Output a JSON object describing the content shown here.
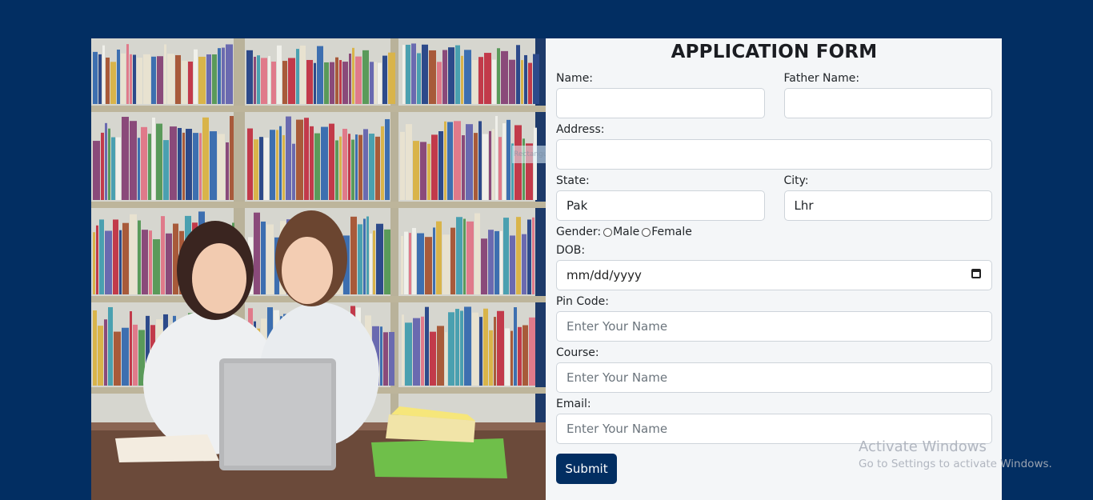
{
  "form": {
    "title": "APPLICATION FORM",
    "name_label": "Name:",
    "name_value": "",
    "father_label": "Father Name:",
    "father_value": "",
    "address_label": "Address:",
    "address_value": "",
    "state_label": "State:",
    "state_value": "Pak",
    "city_label": "City:",
    "city_value": "Lhr",
    "gender_label": "Gender:",
    "gender_options": [
      "Male",
      "Female"
    ],
    "dob_label": "DOB:",
    "dob_placeholder": "mm/dd/yyyy",
    "pin_label": "Pin Code:",
    "pin_placeholder": "Enter Your Name",
    "course_label": "Course:",
    "course_placeholder": "Enter Your Name",
    "email_label": "Email:",
    "email_placeholder": "Enter Your Name",
    "submit_label": "Submit"
  },
  "overlay": {
    "snip_text": "Rectangular Snip"
  },
  "watermark": {
    "line1": "Activate Windows",
    "line2": "Go to Settings to activate Windows."
  },
  "colors": {
    "page_bg": "#022e62",
    "card_bg": "#f4f6f8",
    "button_bg": "#022e62"
  }
}
